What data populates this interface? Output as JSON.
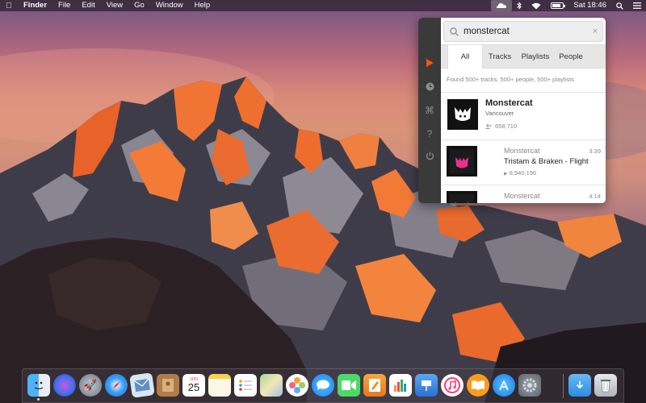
{
  "menubar": {
    "apple_icon": "apple-icon",
    "app_name": "Finder",
    "items": [
      "File",
      "Edit",
      "View",
      "Go",
      "Window",
      "Help"
    ],
    "clock": "Sat 18:46",
    "status_icons": [
      "soundcloud-icon",
      "bluetooth-icon",
      "wifi-icon",
      "battery-icon",
      "spotlight-icon",
      "notification-center-icon"
    ]
  },
  "popup": {
    "sidebar_icons": [
      "play-icon",
      "history-icon",
      "command-icon",
      "help-icon",
      "power-icon"
    ],
    "accent_color": "#ff5500",
    "search": {
      "value": "monstercat",
      "clear_label": "×"
    },
    "tabs": [
      {
        "label": "All",
        "active": true
      },
      {
        "label": "Tracks",
        "active": false
      },
      {
        "label": "Playlists",
        "active": false
      },
      {
        "label": "People",
        "active": false
      }
    ],
    "found_text": "Found 500+ tracks, 500+ people, 500+ playlists",
    "artist": {
      "name": "Monstercat",
      "location": "Vancouver",
      "followers": "658,710"
    },
    "tracks": [
      {
        "user": "Monstercat",
        "title": "Tristam & Braken - Flight",
        "plays": "8,940,196",
        "duration": "3:39"
      },
      {
        "user": "Monstercat",
        "title": "",
        "plays": "",
        "duration": "4:14"
      }
    ]
  },
  "dock": {
    "calendar_month": "JUN",
    "calendar_day": "25",
    "apps": [
      "Finder",
      "Siri",
      "Launchpad",
      "Safari",
      "Mail",
      "Contacts",
      "Calendar",
      "Notes",
      "Reminders",
      "Maps",
      "Photos",
      "Messages",
      "FaceTime",
      "Pages",
      "Numbers",
      "Keynote",
      "iTunes",
      "iBooks",
      "App Store",
      "System Preferences",
      "Downloads",
      "Trash"
    ]
  }
}
